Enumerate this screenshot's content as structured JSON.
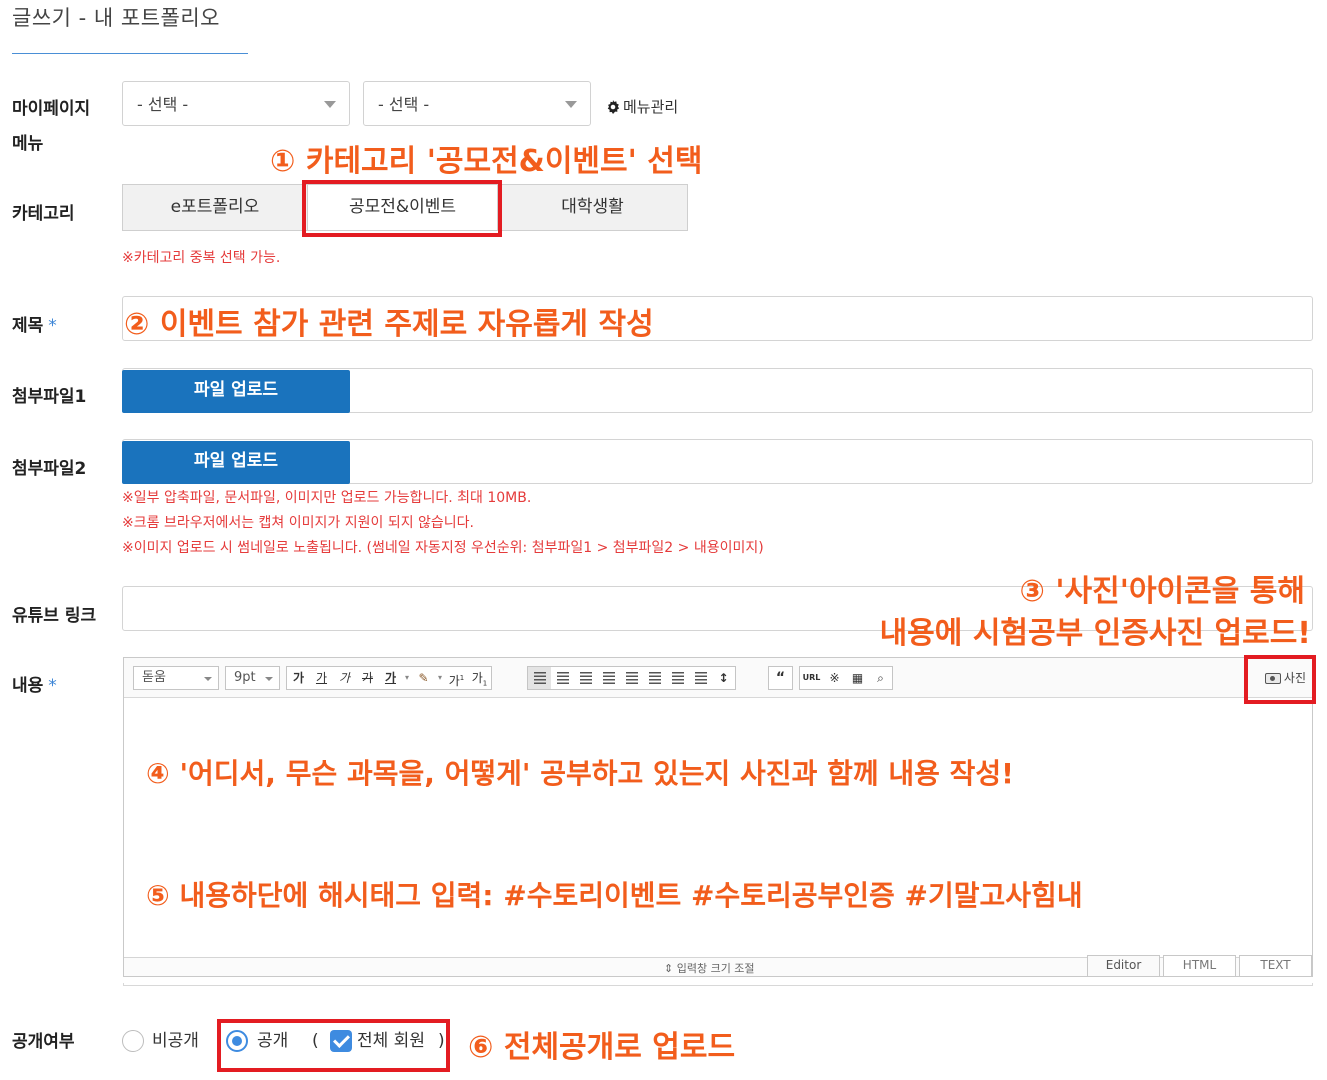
{
  "page": {
    "title": "글쓰기 - 내 포트폴리오"
  },
  "menu": {
    "label_line1": "마이페이지",
    "label_line2": "메뉴",
    "select1": "- 선택 -",
    "select2": "- 선택 -",
    "manage_label": "메뉴관리"
  },
  "category": {
    "label": "카테고리",
    "options": [
      "e포트폴리오",
      "공모전&이벤트",
      "대학생활"
    ],
    "note": "※카테고리 중복 선택 가능."
  },
  "title_field": {
    "label": "제목",
    "required_mark": "*",
    "value": ""
  },
  "attachments": {
    "file1_label": "첨부파일1",
    "file2_label": "첨부파일2",
    "upload_button": "파일 업로드",
    "notes": [
      "※일부 압축파일, 문서파일, 이미지만 업로드 가능합니다. 최대 10MB.",
      "※크롬 브라우저에서는 캡쳐 이미지가 지원이 되지 않습니다.",
      "※이미지 업로드 시 썸네일로 노출됩니다. (썸네일 자동지정 우선순위: 첨부파일1 > 첨부파일2 > 내용이미지)"
    ]
  },
  "youtube": {
    "label": "유튜브 링크",
    "value": ""
  },
  "content": {
    "label": "내용",
    "required_mark": "*",
    "toolbar": {
      "font": "돋움",
      "size": "9pt",
      "photo_label": "사진",
      "url_label": "URL"
    },
    "resize_label": "⇕ 입력창 크기 조절",
    "modes": [
      "Editor",
      "HTML",
      "TEXT"
    ]
  },
  "visibility": {
    "label": "공개여부",
    "private": "비공개",
    "public": "공개",
    "all_members": "전체 회원",
    "paren_open": "(",
    "paren_close": ")"
  },
  "annotations": {
    "step1": "① 카테고리 '공모전&이벤트' 선택",
    "step2": "② 이벤트 참가 관련 주제로 자유롭게 작성",
    "step3_line1": "③ '사진'아이콘을 통해",
    "step3_line2": "내용에 시험공부 인증사진 업로드!",
    "step4": "④  '어디서, 무슨 과목을, 어떻게' 공부하고 있는지 사진과 함께 내용 작성!",
    "step5": "⑤  내용하단에 해시태그 입력: #수토리이벤트 #수토리공부인증 #기말고사힘내",
    "step6": "⑥ 전체공개로 업로드"
  },
  "colors": {
    "accent_blue": "#1a73bd",
    "annotation_orange": "#f25d1c",
    "highlight_red": "#e31c22",
    "note_red": "#e53b3b",
    "radio_blue": "#3e8be0"
  }
}
